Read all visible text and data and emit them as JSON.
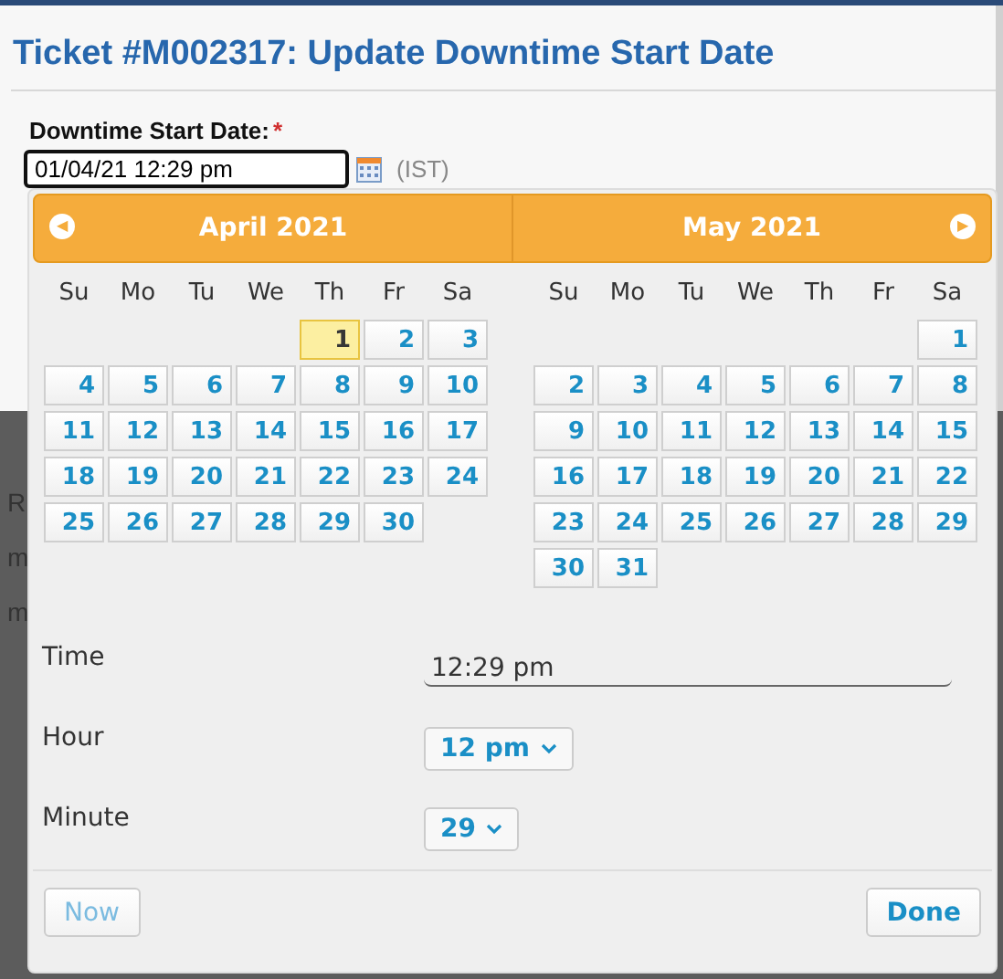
{
  "dialog": {
    "title": "Ticket #M002317: Update Downtime Start Date",
    "field_label": "Downtime Start Date:",
    "required_mark": "*",
    "value": "01/04/21 12:29 pm",
    "timezone": "(IST)"
  },
  "background_fragments": [
    "R",
    "m",
    "m"
  ],
  "datepicker": {
    "prev": "◀",
    "next": "▶",
    "months": [
      {
        "title": "April 2021",
        "weekdays": [
          "Su",
          "Mo",
          "Tu",
          "We",
          "Th",
          "Fr",
          "Sa"
        ],
        "days": [
          {
            "kind": "blank"
          },
          {
            "kind": "blank"
          },
          {
            "kind": "blank"
          },
          {
            "kind": "blank"
          },
          {
            "kind": "day",
            "label": "1",
            "selected": true
          },
          {
            "kind": "day",
            "label": "2",
            "selected": false
          },
          {
            "kind": "day",
            "label": "3",
            "selected": false
          },
          {
            "kind": "day",
            "label": "4",
            "selected": false
          },
          {
            "kind": "day",
            "label": "5",
            "selected": false
          },
          {
            "kind": "day",
            "label": "6",
            "selected": false
          },
          {
            "kind": "day",
            "label": "7",
            "selected": false
          },
          {
            "kind": "day",
            "label": "8",
            "selected": false
          },
          {
            "kind": "day",
            "label": "9",
            "selected": false
          },
          {
            "kind": "day",
            "label": "10",
            "selected": false
          },
          {
            "kind": "day",
            "label": "11",
            "selected": false
          },
          {
            "kind": "day",
            "label": "12",
            "selected": false
          },
          {
            "kind": "day",
            "label": "13",
            "selected": false
          },
          {
            "kind": "day",
            "label": "14",
            "selected": false
          },
          {
            "kind": "day",
            "label": "15",
            "selected": false
          },
          {
            "kind": "day",
            "label": "16",
            "selected": false
          },
          {
            "kind": "day",
            "label": "17",
            "selected": false
          },
          {
            "kind": "day",
            "label": "18",
            "selected": false
          },
          {
            "kind": "day",
            "label": "19",
            "selected": false
          },
          {
            "kind": "day",
            "label": "20",
            "selected": false
          },
          {
            "kind": "day",
            "label": "21",
            "selected": false
          },
          {
            "kind": "day",
            "label": "22",
            "selected": false
          },
          {
            "kind": "day",
            "label": "23",
            "selected": false
          },
          {
            "kind": "day",
            "label": "24",
            "selected": false
          },
          {
            "kind": "day",
            "label": "25",
            "selected": false
          },
          {
            "kind": "day",
            "label": "26",
            "selected": false
          },
          {
            "kind": "day",
            "label": "27",
            "selected": false
          },
          {
            "kind": "day",
            "label": "28",
            "selected": false
          },
          {
            "kind": "day",
            "label": "29",
            "selected": false
          },
          {
            "kind": "day",
            "label": "30",
            "selected": false
          }
        ]
      },
      {
        "title": "May 2021",
        "weekdays": [
          "Su",
          "Mo",
          "Tu",
          "We",
          "Th",
          "Fr",
          "Sa"
        ],
        "days": [
          {
            "kind": "blank"
          },
          {
            "kind": "blank"
          },
          {
            "kind": "blank"
          },
          {
            "kind": "blank"
          },
          {
            "kind": "blank"
          },
          {
            "kind": "blank"
          },
          {
            "kind": "day",
            "label": "1",
            "selected": false
          },
          {
            "kind": "day",
            "label": "2",
            "selected": false
          },
          {
            "kind": "day",
            "label": "3",
            "selected": false
          },
          {
            "kind": "day",
            "label": "4",
            "selected": false
          },
          {
            "kind": "day",
            "label": "5",
            "selected": false
          },
          {
            "kind": "day",
            "label": "6",
            "selected": false
          },
          {
            "kind": "day",
            "label": "7",
            "selected": false
          },
          {
            "kind": "day",
            "label": "8",
            "selected": false
          },
          {
            "kind": "day",
            "label": "9",
            "selected": false
          },
          {
            "kind": "day",
            "label": "10",
            "selected": false
          },
          {
            "kind": "day",
            "label": "11",
            "selected": false
          },
          {
            "kind": "day",
            "label": "12",
            "selected": false
          },
          {
            "kind": "day",
            "label": "13",
            "selected": false
          },
          {
            "kind": "day",
            "label": "14",
            "selected": false
          },
          {
            "kind": "day",
            "label": "15",
            "selected": false
          },
          {
            "kind": "day",
            "label": "16",
            "selected": false
          },
          {
            "kind": "day",
            "label": "17",
            "selected": false
          },
          {
            "kind": "day",
            "label": "18",
            "selected": false
          },
          {
            "kind": "day",
            "label": "19",
            "selected": false
          },
          {
            "kind": "day",
            "label": "20",
            "selected": false
          },
          {
            "kind": "day",
            "label": "21",
            "selected": false
          },
          {
            "kind": "day",
            "label": "22",
            "selected": false
          },
          {
            "kind": "day",
            "label": "23",
            "selected": false
          },
          {
            "kind": "day",
            "label": "24",
            "selected": false
          },
          {
            "kind": "day",
            "label": "25",
            "selected": false
          },
          {
            "kind": "day",
            "label": "26",
            "selected": false
          },
          {
            "kind": "day",
            "label": "27",
            "selected": false
          },
          {
            "kind": "day",
            "label": "28",
            "selected": false
          },
          {
            "kind": "day",
            "label": "29",
            "selected": false
          },
          {
            "kind": "day",
            "label": "30",
            "selected": false
          },
          {
            "kind": "day",
            "label": "31",
            "selected": false
          }
        ]
      }
    ],
    "time": {
      "label": "Time",
      "value": "12:29 pm"
    },
    "hour": {
      "label": "Hour",
      "value": "12 pm"
    },
    "minute": {
      "label": "Minute",
      "value": "29"
    },
    "buttons": [
      {
        "label": "Now",
        "disabled": true
      },
      {
        "label": "Done",
        "disabled": false
      }
    ]
  }
}
